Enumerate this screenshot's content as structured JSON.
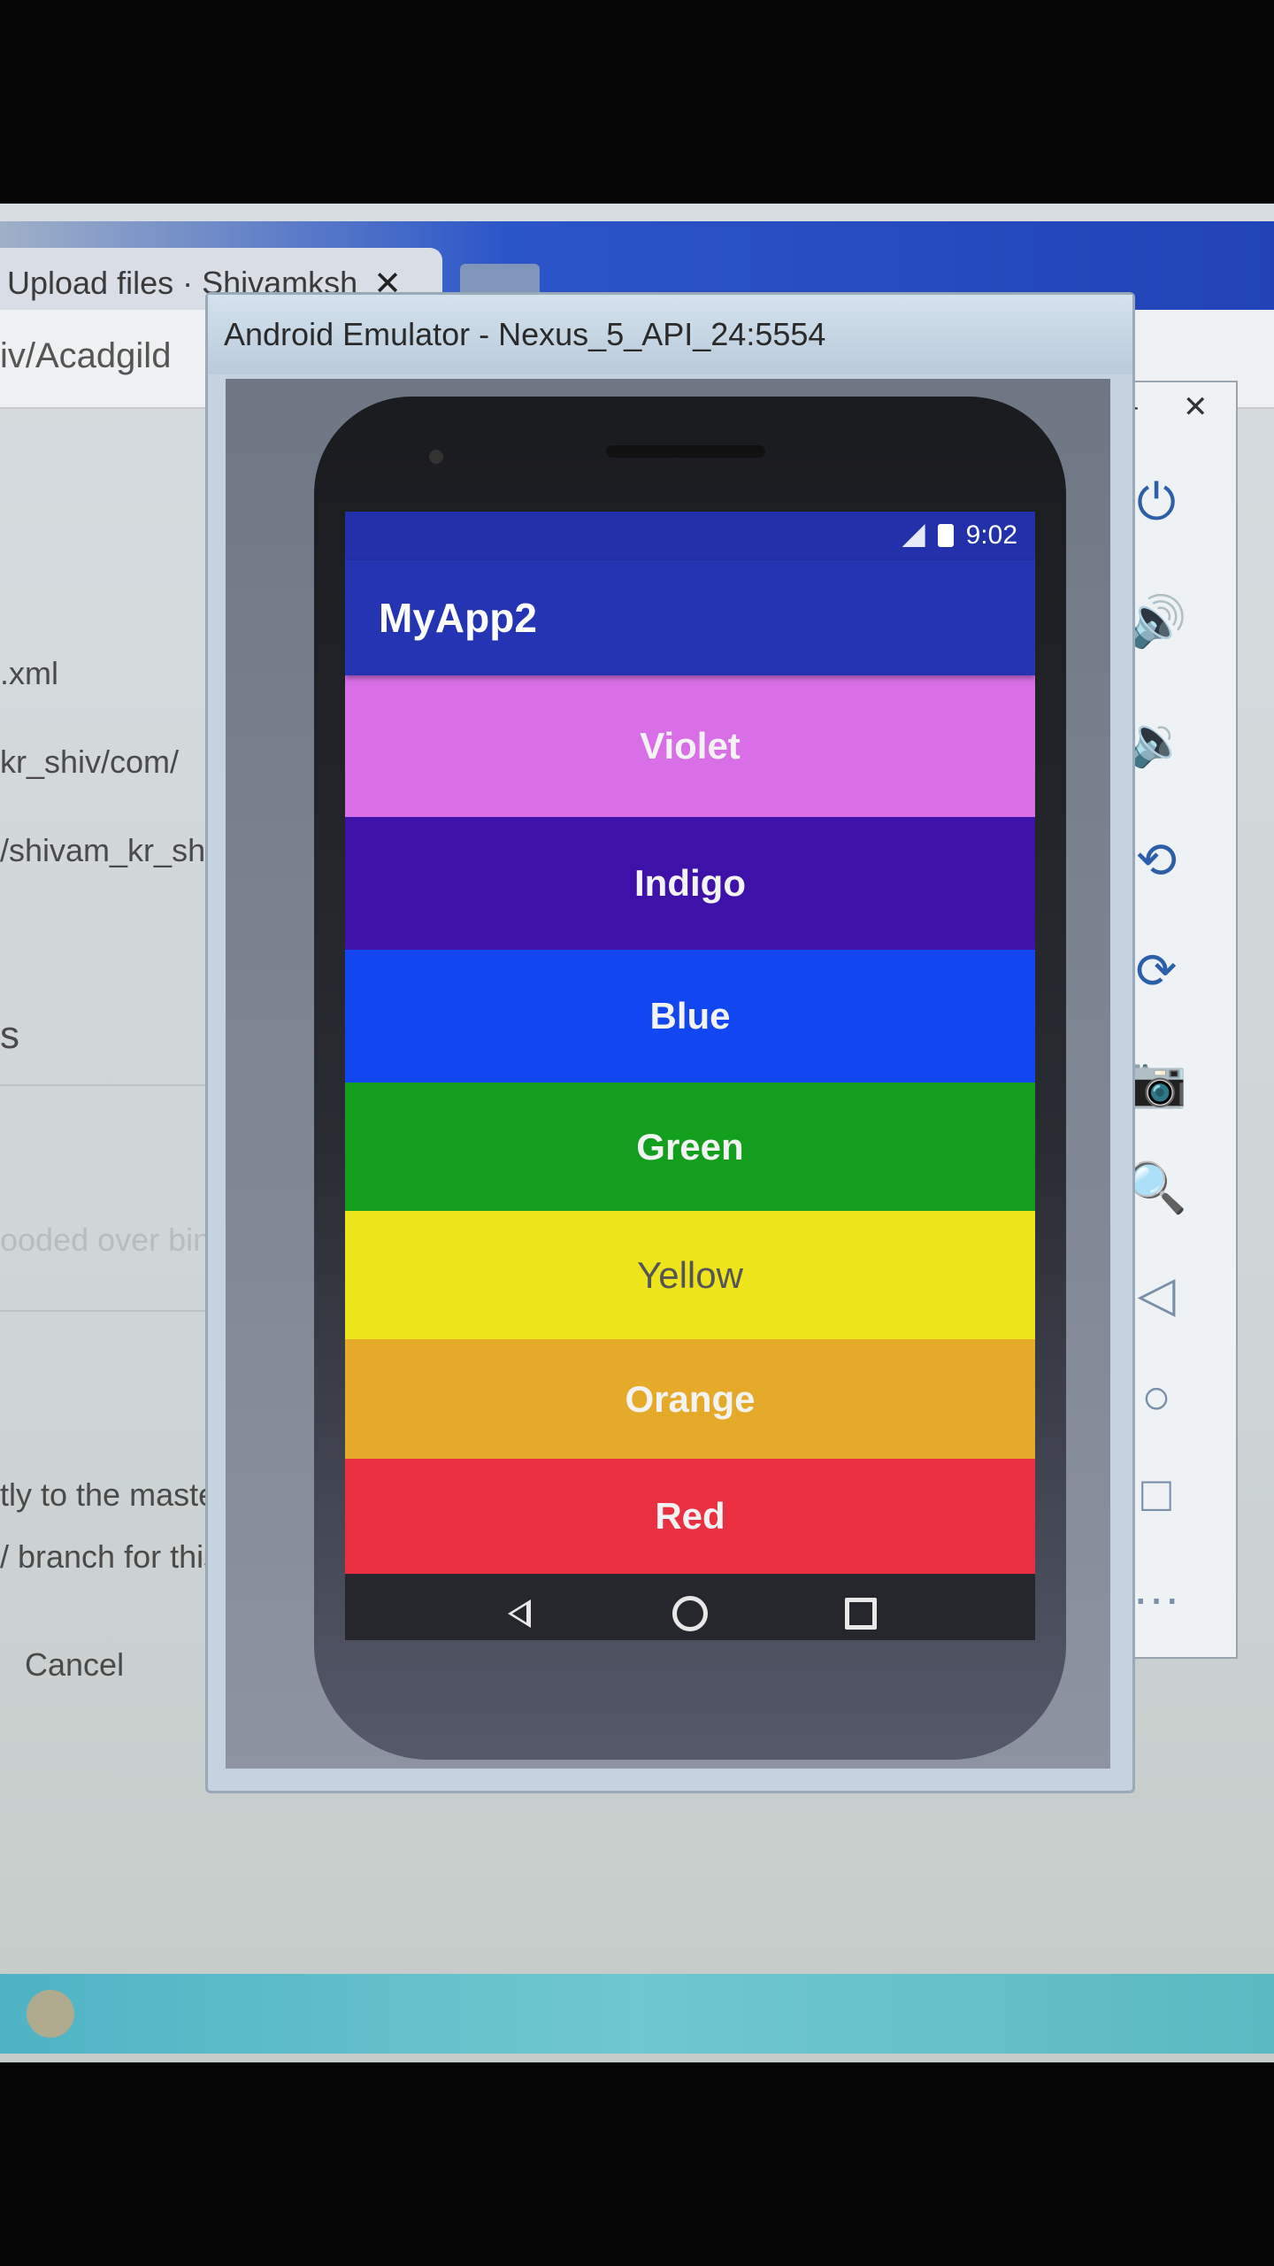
{
  "browser": {
    "tab_label": "Upload files · Shivamksh",
    "tab_close": "✕",
    "address": "iv/Acadgild"
  },
  "page": {
    "lines": [
      ".xml",
      "kr_shiv/com/",
      "/shivam_kr_sh",
      "s"
    ],
    "faint_line": "ooded over bin/",
    "commit_line_1": "tly to the  maste",
    "commit_line_2": "/ branch for this c",
    "cancel": "Cancel"
  },
  "emulator": {
    "title": "Android Emulator - Nexus_5_API_24:5554",
    "status_time": "9:02",
    "app_title": "MyApp2",
    "bands": [
      {
        "label": "Violet",
        "color": "#d86fe6"
      },
      {
        "label": "Indigo",
        "color": "#3e12a8"
      },
      {
        "label": "Blue",
        "color": "#1246f0"
      },
      {
        "label": "Green",
        "color": "#139e1d"
      },
      {
        "label": "Yellow",
        "color": "#ede41b"
      },
      {
        "label": "Orange",
        "color": "#e6aa2a"
      },
      {
        "label": "Red",
        "color": "#ea3040"
      }
    ],
    "nav": [
      "back-icon",
      "home-icon",
      "recents-icon"
    ]
  },
  "toolbar": {
    "minimize": "–",
    "close": "✕",
    "items": [
      {
        "icon": "power-icon",
        "glyph": "⏻"
      },
      {
        "icon": "volume-up-icon",
        "glyph": "🔊"
      },
      {
        "icon": "volume-down-icon",
        "glyph": "🔉"
      },
      {
        "icon": "rotate-left-icon",
        "glyph": "⟲"
      },
      {
        "icon": "rotate-right-icon",
        "glyph": "⟳"
      },
      {
        "icon": "camera-icon",
        "glyph": "📷"
      },
      {
        "icon": "zoom-icon",
        "glyph": "🔍"
      },
      {
        "icon": "back-icon",
        "glyph": "◁"
      },
      {
        "icon": "home-icon",
        "glyph": "○"
      },
      {
        "icon": "overview-icon",
        "glyph": "□"
      },
      {
        "icon": "more-icon",
        "glyph": "…"
      }
    ]
  }
}
